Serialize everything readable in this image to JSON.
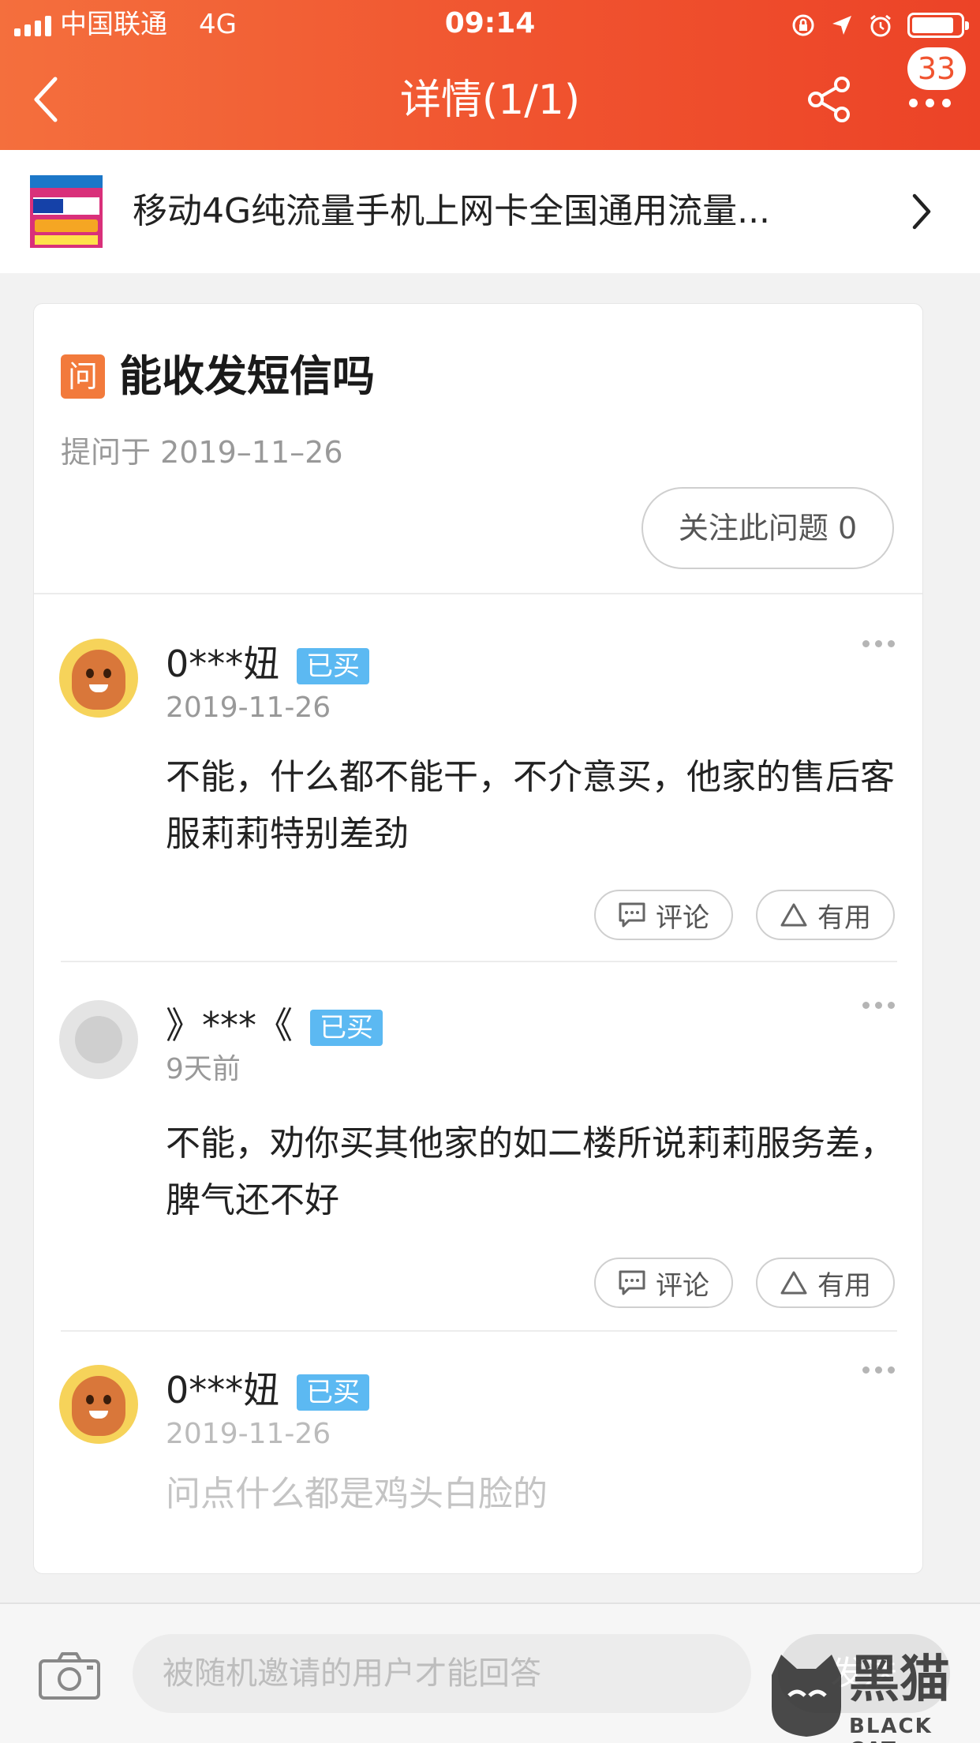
{
  "status_bar": {
    "carrier": "中国联通",
    "network": "4G",
    "time": "09:14"
  },
  "nav": {
    "title": "详情(1/1)",
    "badge": "33"
  },
  "product": {
    "title": "移动4G纯流量手机上网卡全国通用流量..."
  },
  "question": {
    "icon_label": "问",
    "title": "能收发短信吗",
    "date": "提问于 2019–11–26",
    "follow_label": "关注此问题 0"
  },
  "answers": [
    {
      "name": "0***妞",
      "badge": "已买",
      "date": "2019-11-26",
      "text": "不能，什么都不能干，不介意买，他家的售后客服莉莉特别差劲",
      "comment_label": "评论",
      "useful_label": "有用"
    },
    {
      "name": "》***《",
      "badge": "已买",
      "date": "9天前",
      "text": "不能，劝你买其他家的如二楼所说莉莉服务差，脾气还不好",
      "comment_label": "评论",
      "useful_label": "有用"
    },
    {
      "name": "0***妞",
      "badge": "已买",
      "date": "2019-11-26",
      "text": "问点什么都是鸡头白脸的"
    }
  ],
  "bottom": {
    "placeholder": "被随机邀请的用户才能回答",
    "send_label": "发送"
  },
  "watermark": {
    "title": "黑猫",
    "subtitle": "BLACK CAT"
  },
  "colors": {
    "header_accent": "#f0532f",
    "question_icon": "#f27a3c",
    "bought_badge": "#5cb9f2"
  },
  "icons": [
    "back-icon",
    "share-icon",
    "more-icon",
    "chevron-right-icon",
    "comment-icon",
    "useful-icon",
    "camera-icon",
    "battery-icon",
    "location-icon",
    "alarm-icon",
    "orientation-lock-icon"
  ]
}
